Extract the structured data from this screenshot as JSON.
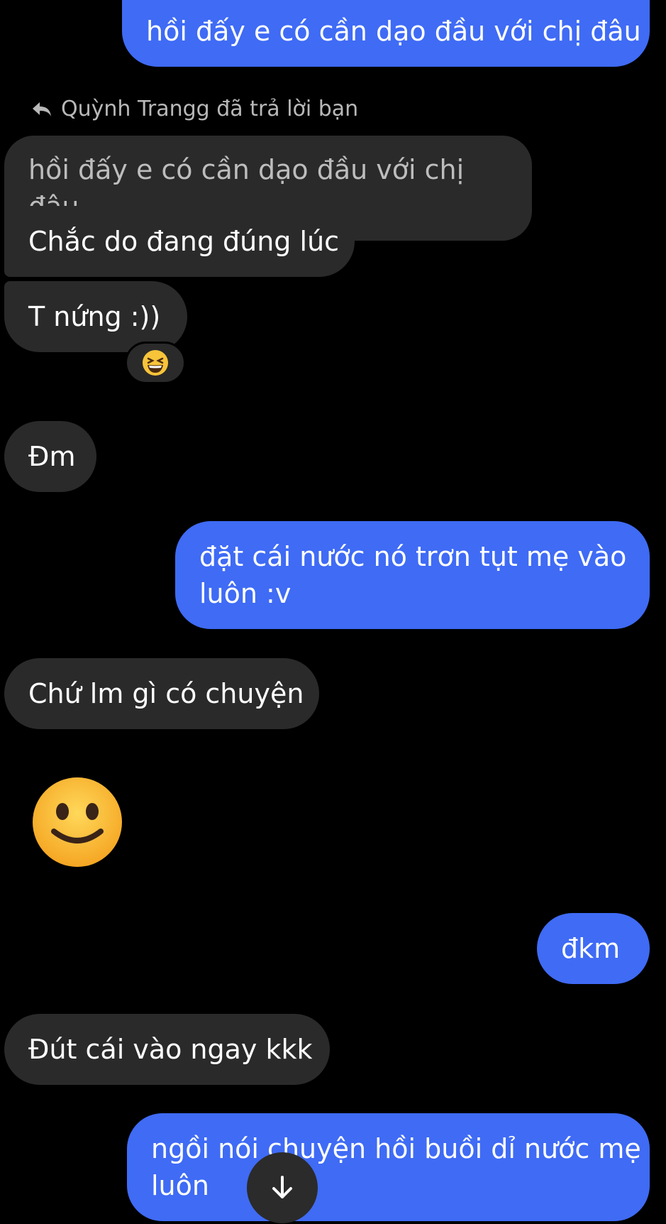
{
  "messages": {
    "m1": "hồi đấy e có cần dạo đầu với chị đâu",
    "reply_context": "Quỳnh Trangg đã trả lời bạn",
    "quoted": "hồi đấy e có cần dạo đầu với chị đâu",
    "m2": "Chắc do đang đúng lúc",
    "m3": "T nứng :))",
    "m4": "Đm",
    "m5_line1": "đặt cái nước nó trơn tụt mẹ vào",
    "m5_line2": "luôn :v",
    "m6": "Chứ lm gì có chuyện",
    "m7": "đkm",
    "m8": "Đút cái vào ngay kkk",
    "m9_line1": "ngồi nói chuyện hồi buồi dỉ nước mẹ",
    "m9_line2": "luôn"
  },
  "reaction_emoji": "laughing-squint",
  "big_emoji": "slightly-smiling-face",
  "colors": {
    "outgoing_bubble": "#3f6bf5",
    "incoming_bubble": "#2a2a2a",
    "background": "#000000"
  }
}
